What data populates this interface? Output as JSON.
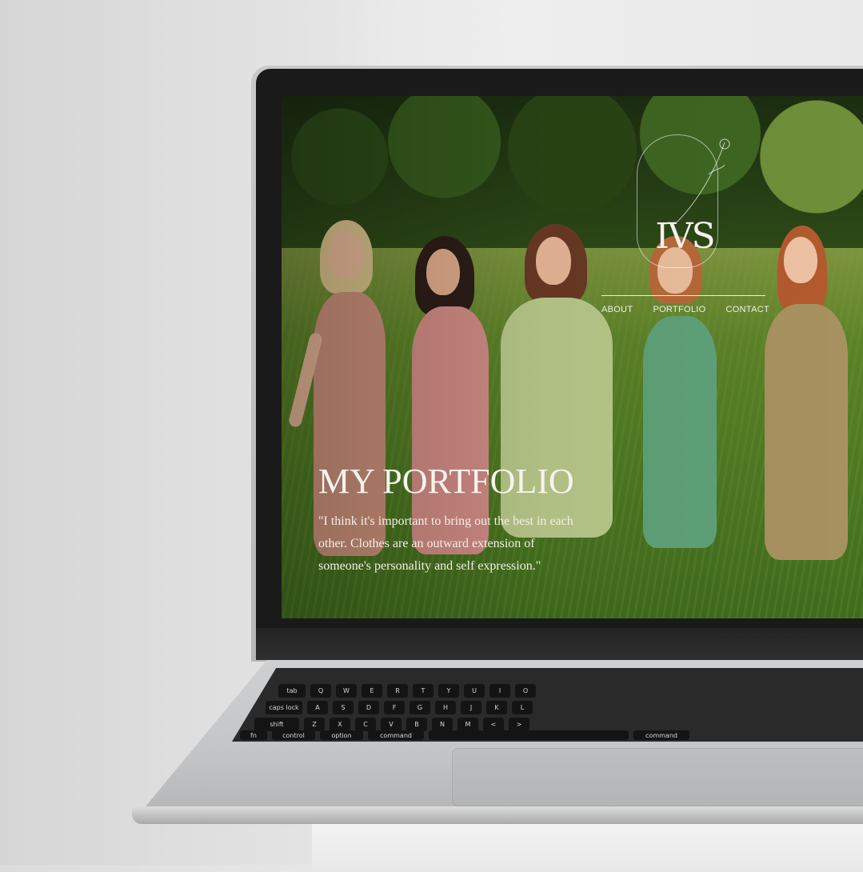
{
  "site": {
    "logo": "IVS",
    "nav": [
      "ABOUT",
      "PORTFOLIO",
      "CONTACT"
    ],
    "hero_title": "MY PORTFOLIO",
    "quote": "\"I think it's important to bring out the best in each other. Clothes are an outward extension of someone's personality and self expression.\""
  },
  "keyboard": {
    "row1": [
      "tab",
      "Q",
      "W",
      "E",
      "R",
      "T",
      "Y",
      "U",
      "I",
      "O"
    ],
    "row2": [
      "caps lock",
      "A",
      "S",
      "D",
      "F",
      "G",
      "H",
      "J",
      "K",
      "L"
    ],
    "row3": [
      "shift",
      "Z",
      "X",
      "C",
      "V",
      "B",
      "N",
      "M",
      "<",
      ">"
    ],
    "row4": [
      "fn",
      "control",
      "option",
      "command",
      "",
      "command"
    ]
  },
  "colors": {
    "dress_1": "#c98f79",
    "dress_2": "#d28c86",
    "dress_3": "#b9c98a",
    "dress_4": "#5fa279",
    "dress_5": "#a7925f",
    "text_light": "#f4efe6"
  }
}
